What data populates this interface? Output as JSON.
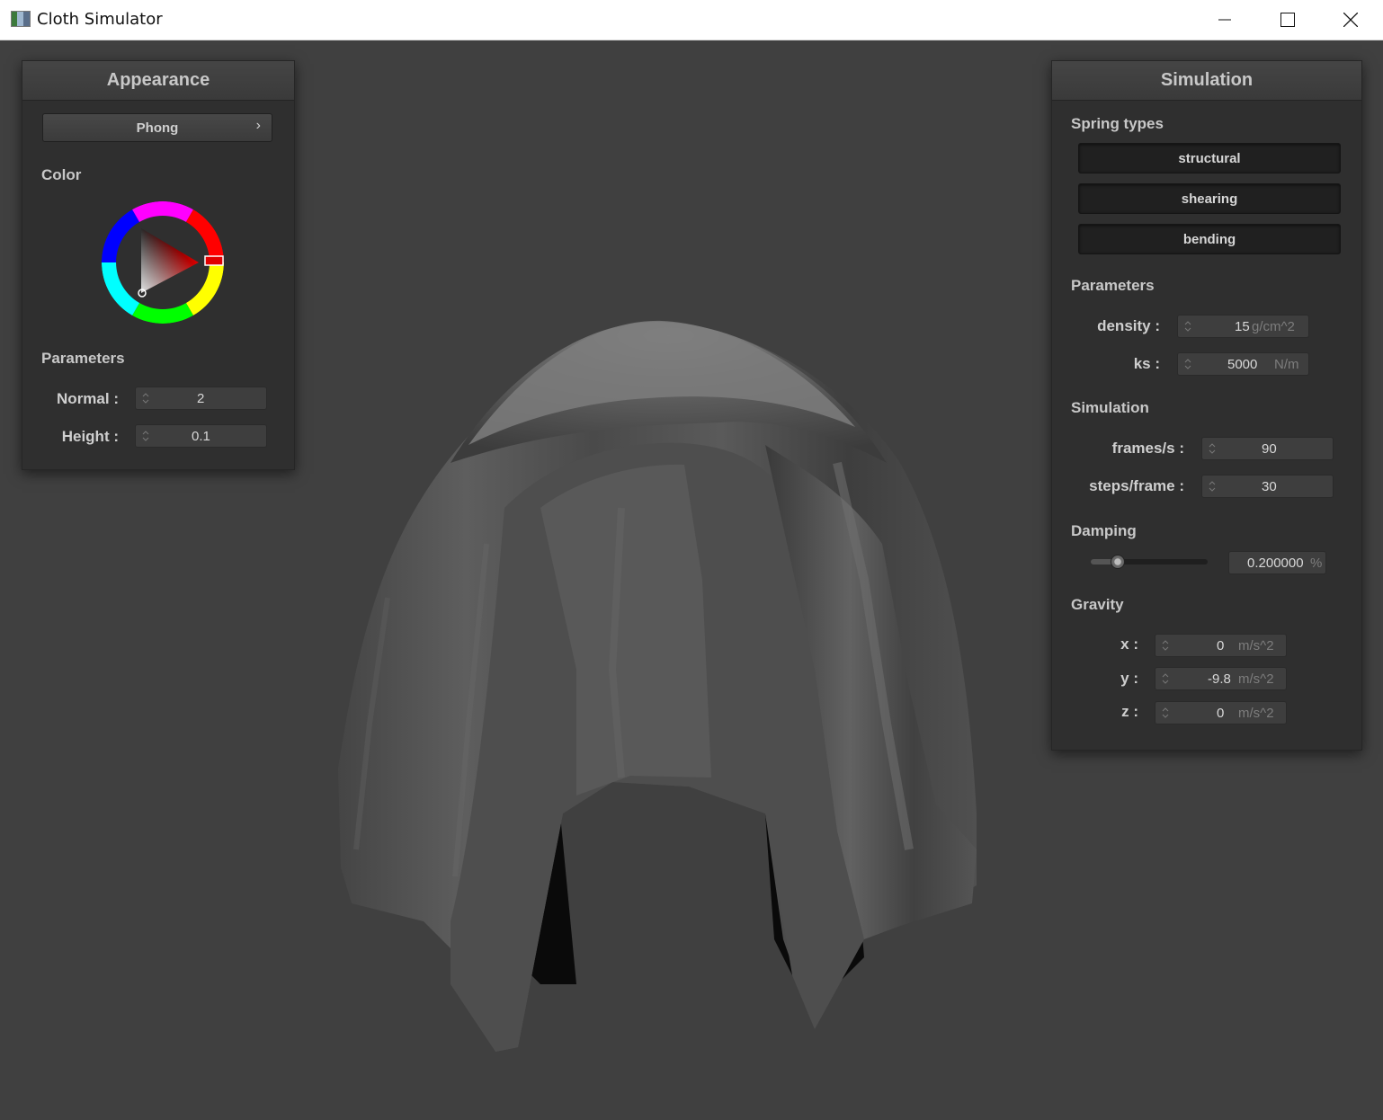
{
  "window": {
    "title": "Cloth Simulator",
    "buttons": [
      "minimize-icon",
      "maximize-icon",
      "close-icon"
    ]
  },
  "appearance": {
    "title": "Appearance",
    "shader": "Phong",
    "shader_chevron": "›",
    "color_label": "Color",
    "selected_color": "#e00000",
    "parameters_label": "Parameters",
    "normal": {
      "label": "Normal :",
      "value": "2"
    },
    "height": {
      "label": "Height :",
      "value": "0.1"
    }
  },
  "simulation": {
    "title": "Simulation",
    "spring_types_label": "Spring types",
    "springs": [
      "structural",
      "shearing",
      "bending"
    ],
    "parameters_label": "Parameters",
    "density": {
      "label": "density :",
      "value": "15",
      "unit": "g/cm^2"
    },
    "ks": {
      "label": "ks :",
      "value": "5000",
      "unit": "N/m"
    },
    "simulation_label": "Simulation",
    "frames": {
      "label": "frames/s :",
      "value": "90"
    },
    "steps": {
      "label": "steps/frame :",
      "value": "30"
    },
    "damping_label": "Damping",
    "damping": {
      "value": "0.200000",
      "unit": "%",
      "slider_fraction": 0.2
    },
    "gravity_label": "Gravity",
    "gravity": [
      {
        "label": "x :",
        "value": "0",
        "unit": "m/s^2"
      },
      {
        "label": "y :",
        "value": "-9.8",
        "unit": "m/s^2"
      },
      {
        "label": "z :",
        "value": "0",
        "unit": "m/s^2"
      }
    ]
  },
  "colors": {
    "background": "#404040",
    "panel": "#2f2f2f",
    "cloth": "#5a5a5a"
  }
}
